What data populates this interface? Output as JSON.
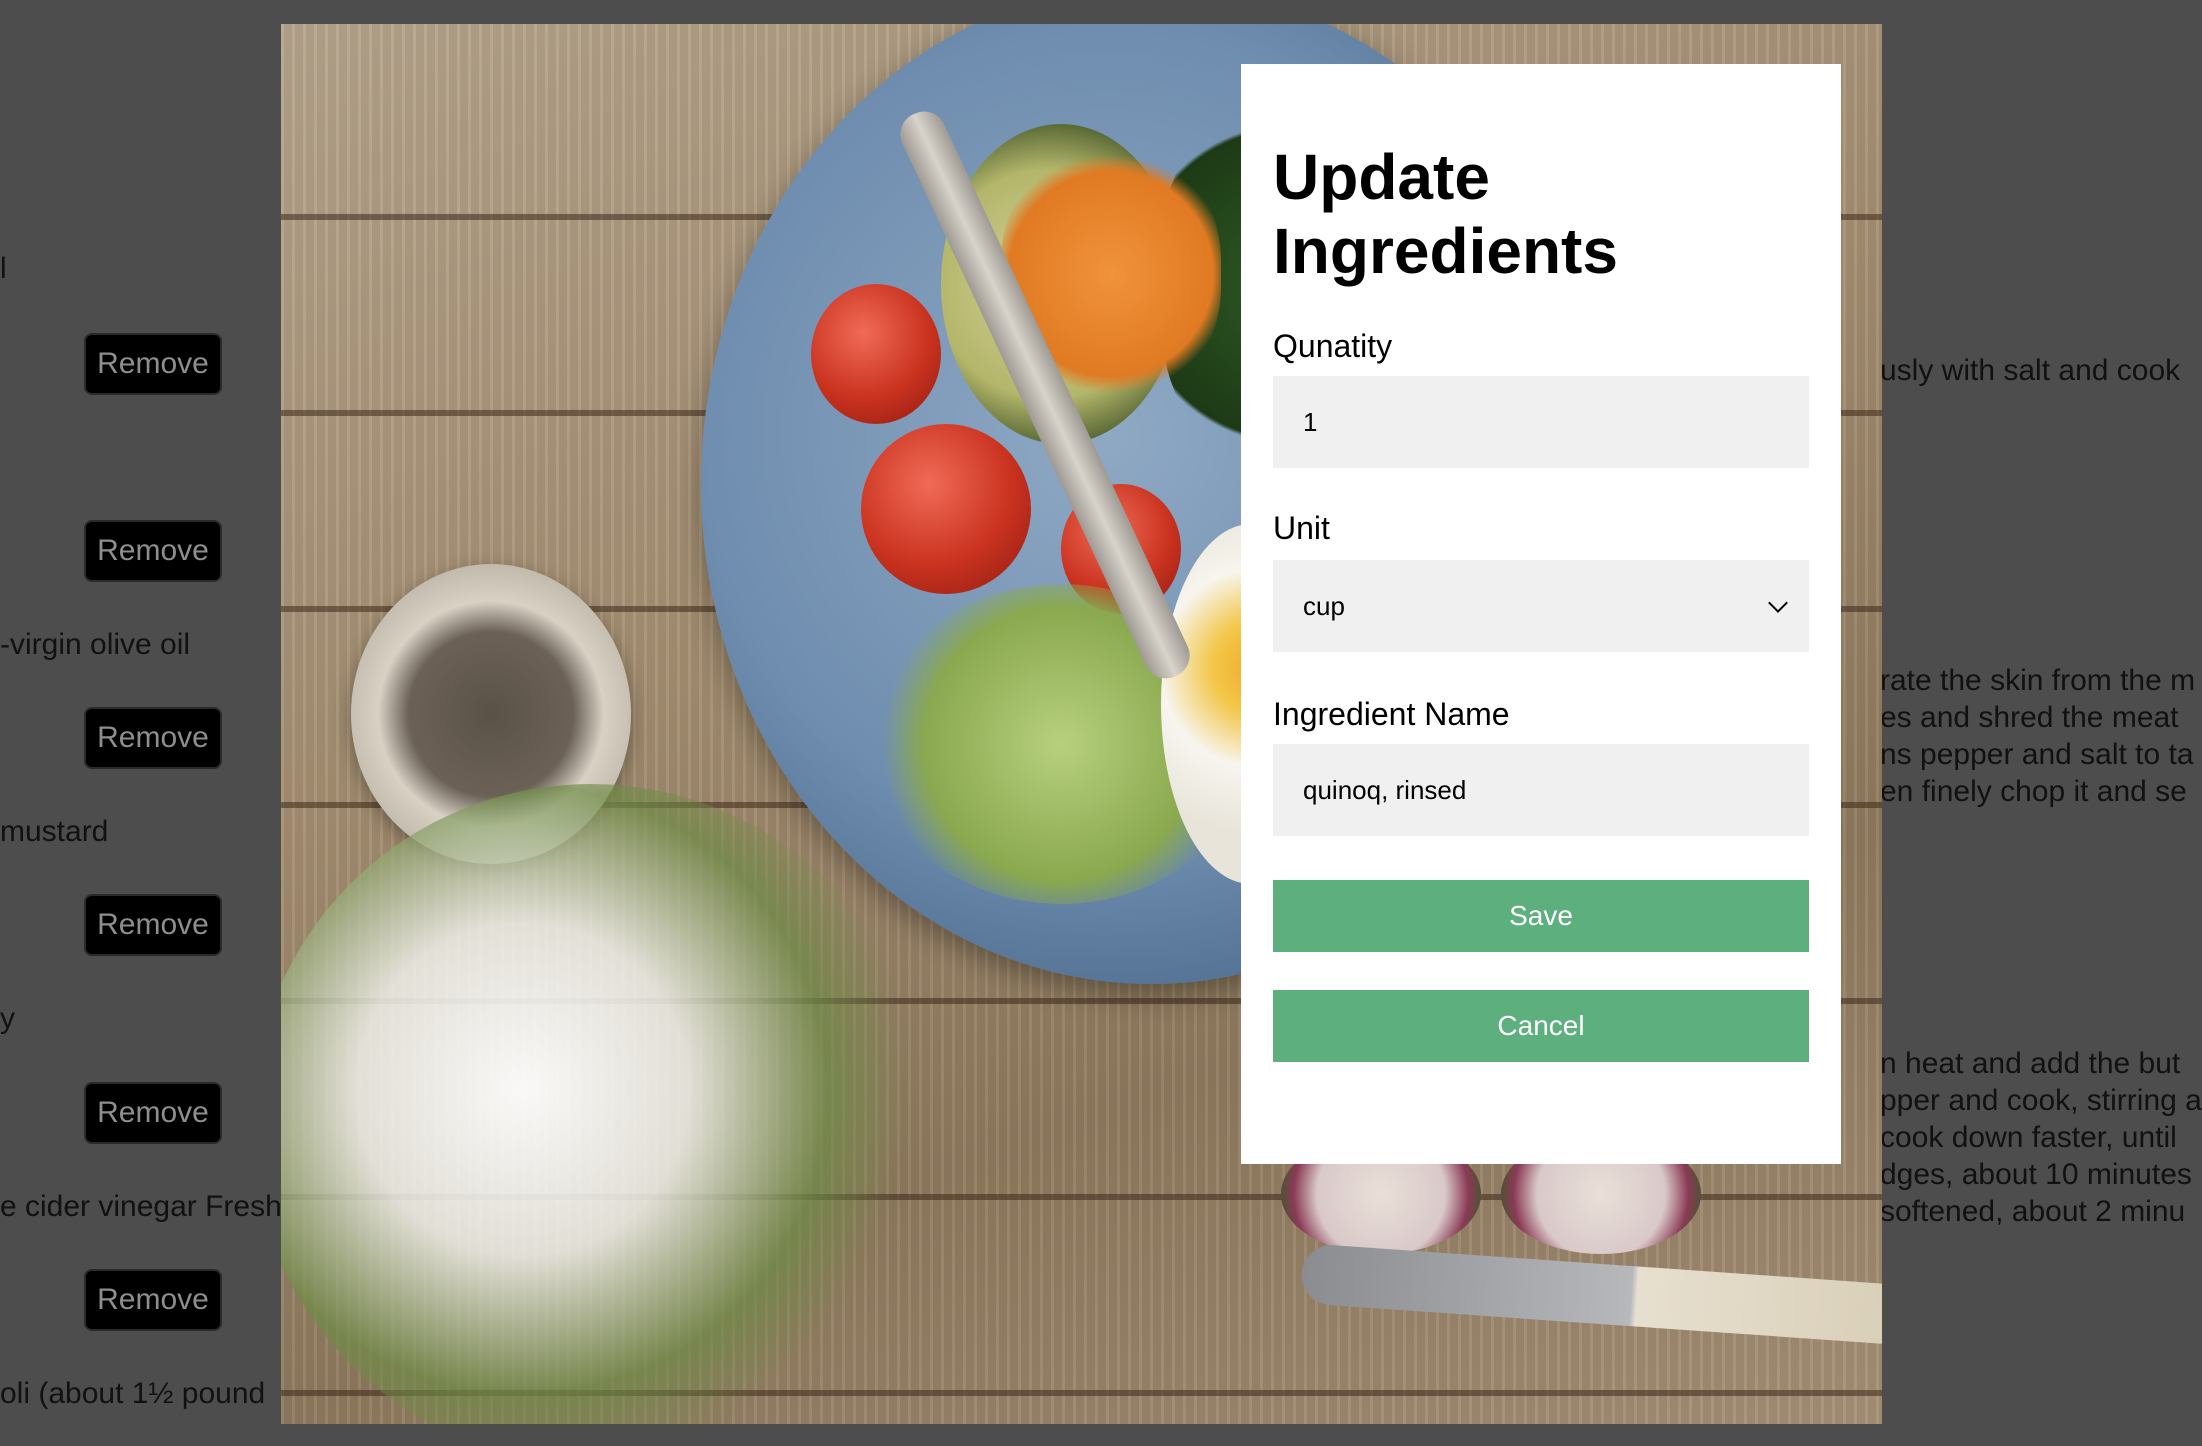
{
  "modal": {
    "title": "Update Ingredients",
    "quantity": {
      "label": "Qunatity",
      "value": "1"
    },
    "unit": {
      "label": "Unit",
      "value": "cup"
    },
    "ingredient_name": {
      "label": "Ingredient Name",
      "value": "quinoq, rinsed"
    },
    "save_label": "Save",
    "cancel_label": "Cancel"
  },
  "background_ingredients": {
    "lines": [
      "l",
      "-virgin olive oil",
      " mustard",
      "y",
      "e cider vinegar Fresh",
      "oli (about 1½ pound"
    ],
    "remove_label": "Remove"
  },
  "background_steps": {
    "lines": [
      "usly with salt and cook",
      "rate the skin from the m",
      "es and shred the meat",
      "ns pepper and salt to ta",
      "en finely chop it and se",
      "n heat and add the but",
      "pper and cook, stirring a",
      "cook down faster, until",
      "dges, about 10 minutes",
      " softened, about 2 minu"
    ]
  },
  "colors": {
    "overlay": "#4d4d4d",
    "accent": "#5db07e",
    "field_bg": "#f0f0f0"
  },
  "icons": {
    "unit_dropdown": "chevron-down-icon"
  }
}
